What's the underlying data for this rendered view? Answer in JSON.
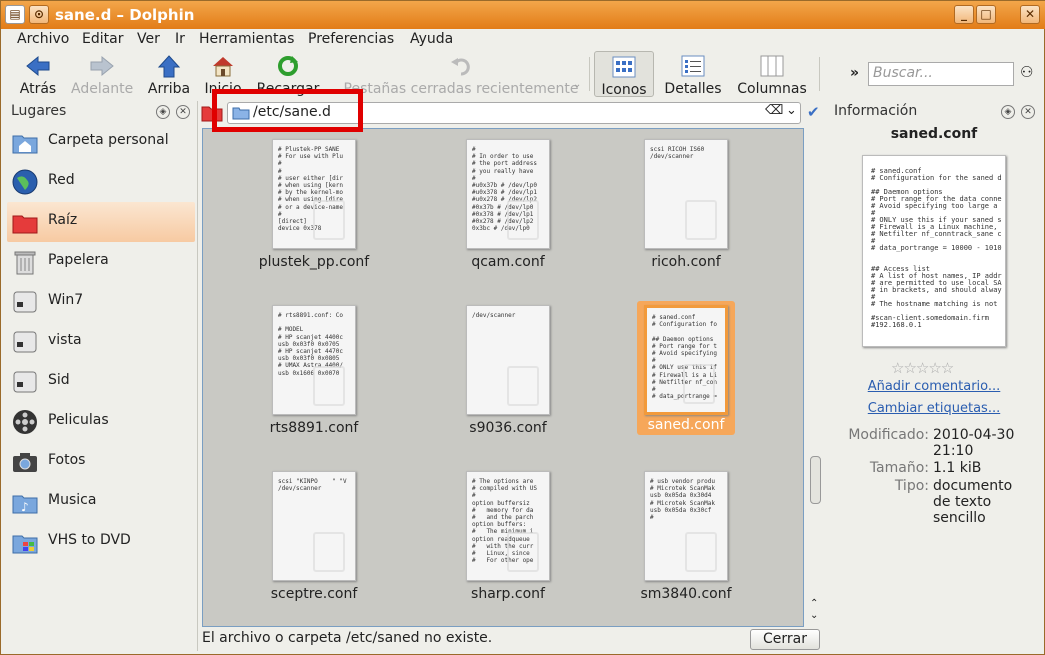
{
  "window": {
    "title": "sane.d – Dolphin"
  },
  "menu": [
    "Archivo",
    "Editar",
    "Ver",
    "Ir",
    "Herramientas",
    "Preferencias",
    "Ayuda"
  ],
  "toolbar": {
    "back": "Atrás",
    "forward": "Adelante",
    "up": "Arriba",
    "home": "Inicio",
    "reload": "Recargar",
    "closed_tabs": "Pestañas cerradas recientemente",
    "icons": "Iconos",
    "details": "Detalles",
    "columns": "Columnas",
    "search_placeholder": "Buscar..."
  },
  "places": {
    "title": "Lugares",
    "items": [
      {
        "label": "Carpeta personal"
      },
      {
        "label": "Red"
      },
      {
        "label": "Raíz"
      },
      {
        "label": "Papelera"
      },
      {
        "label": "Win7"
      },
      {
        "label": "vista"
      },
      {
        "label": "Sid"
      },
      {
        "label": "Peliculas"
      },
      {
        "label": "Fotos"
      },
      {
        "label": "Musica"
      },
      {
        "label": "VHS to DVD"
      }
    ]
  },
  "location": {
    "path": "/etc/sane.d"
  },
  "files": [
    {
      "name": "plustek_pp.conf",
      "preview": "# Plustek-PP SANE\n# For use with Plu\n#\n#\n# user either [dir\n# when using [kern\n# by the kernel-mo\n# when using [dire\n# or a device-name\n#\n[direct]\ndevice 0x378"
    },
    {
      "name": "qcam.conf",
      "preview": "#\n# In order to use\n# the port address\n# you really have\n#\n#u0x37b # /dev/lp0\n#u0x378 # /dev/lp1\n#u0x278 # /dev/lp2\n#0x37b # /dev/lp0\n#0x378 # /dev/lp1\n#0x278 # /dev/lp2\n0x3bc # /dev/lp0"
    },
    {
      "name": "ricoh.conf",
      "preview": "scsi RICOH IS60\n/dev/scanner"
    },
    {
      "name": "rts8891.conf",
      "preview": "# rts8891.conf: Co\n\n# MODEL\n# HP scanjet 4400c\nusb 0x03f0 0x0705\n# HP scanjet 4470c\nusb 0x03f0 0x0805\n# UMAX Astra 4400/\nusb 0x1606 0x0070"
    },
    {
      "name": "s9036.conf",
      "preview": "/dev/scanner"
    },
    {
      "name": "saned.conf",
      "preview": "# saned.conf\n# Configuration fo\n\n## Daemon options\n# Port range for t\n# Avoid specifying\n#\n# ONLY use this if\n# Firewall is a Li\n# Netfilter nf_con\n#\n# data_portrange ="
    },
    {
      "name": "sceptre.conf",
      "preview": "scsi \"KINPO    \" \"V\n/dev/scanner"
    },
    {
      "name": "sharp.conf",
      "preview": "# The options are\n# compiled with US\n#\noption buffersiz\n#   memory for da\n#   and the parch\noption buffers:\n#   The minimum i\noption readqueue\n#   with the curr\n#   Linux, since\n#   For other ope"
    },
    {
      "name": "sm3840.conf",
      "preview": "# usb vendor produ\n# Microtek ScanMak\nusb 0x05da 0x30d4\n# Microtek ScanMak\nusb 0x05da 0x30cf\n#"
    }
  ],
  "selected_file": "saned.conf",
  "status": {
    "message": "El archivo o carpeta /etc/saned no existe.",
    "close": "Cerrar"
  },
  "info": {
    "title": "Información",
    "filename": "saned.conf",
    "preview": "# saned.conf\n# Configuration for the saned d\n\n## Daemon options\n# Port range for the data conne\n# Avoid specifying too large a\n#\n# ONLY use this if your saned s\n# Firewall is a Linux machine,\n# Netfilter nf_conntrack_sane c\n#\n# data_portrange = 10000 - 1010\n\n\n## Access list\n# A list of host names, IP addr\n# are permitted to use local SA\n# in brackets, and should alway\n#\n# The hostname matching is not\n\n#scan-client.somedomain.firm\n#192.168.0.1",
    "add_comment": "Añadir comentario...",
    "change_tags": "Cambiar etiquetas...",
    "modified_label": "Modificado:",
    "modified_value": "2010-04-30 21:10",
    "size_label": "Tamaño:",
    "size_value": "1.1 kiB",
    "type_label": "Tipo:",
    "type_value": "documento de texto sencillo"
  }
}
